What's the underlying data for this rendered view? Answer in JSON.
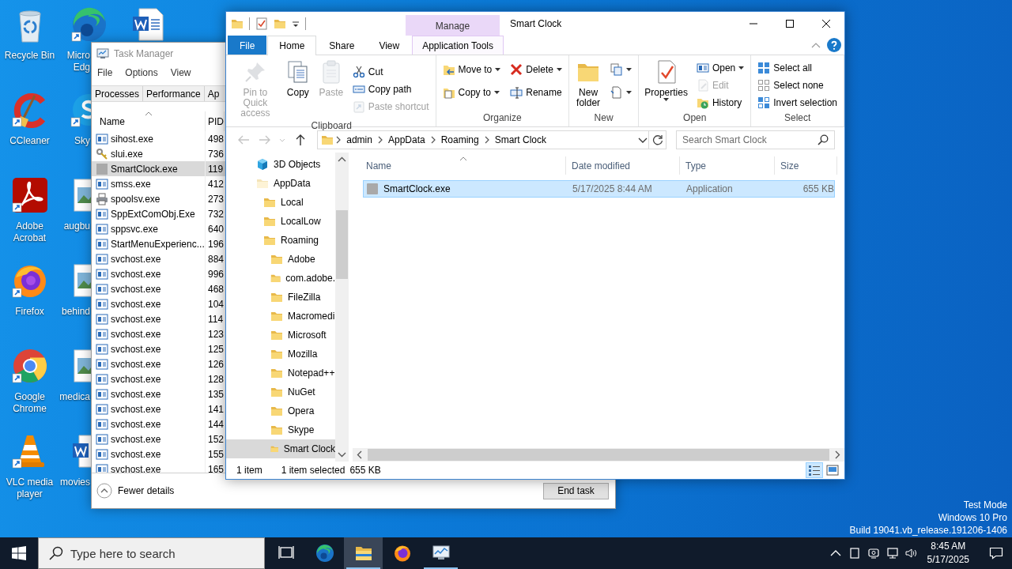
{
  "desktop": {
    "icons": [
      {
        "kind": "recycle",
        "label": "Recycle Bin",
        "shortcut": false
      },
      {
        "kind": "ccleaner",
        "label": "CCleaner",
        "shortcut": true
      },
      {
        "kind": "acrobat",
        "label": "Adobe Acrobat",
        "shortcut": true
      },
      {
        "kind": "firefox",
        "label": "Firefox",
        "shortcut": true
      },
      {
        "kind": "chrome",
        "label": "Google Chrome",
        "shortcut": true
      },
      {
        "kind": "vlc",
        "label": "VLC media player",
        "shortcut": true
      },
      {
        "kind": "edge",
        "label": "Micro Edg",
        "shortcut": true
      },
      {
        "kind": "skype",
        "label": "Sky",
        "shortcut": true
      },
      {
        "kind": "image",
        "label": "augbu",
        "shortcut": false
      },
      {
        "kind": "image",
        "label": "behind",
        "shortcut": false
      },
      {
        "kind": "image",
        "label": "medica",
        "shortcut": false
      },
      {
        "kind": "word",
        "label": "movies",
        "shortcut": false
      },
      {
        "kind": "word",
        "shortcut": false
      }
    ],
    "system_notice": [
      "Test Mode",
      "Windows 10 Pro",
      "Build 19041.vb_release.191206-1406"
    ]
  },
  "task_manager": {
    "title": "Task Manager",
    "menu": [
      "File",
      "Options",
      "View"
    ],
    "tabs": [
      "Processes",
      "Performance",
      "Ap"
    ],
    "columns": [
      {
        "label": "Name",
        "sorted": true
      },
      {
        "label": "PID",
        "sorted": false
      }
    ],
    "processes": [
      {
        "name": "sihost.exe",
        "pid": "498",
        "kind": "app",
        "selected": false
      },
      {
        "name": "slui.exe",
        "pid": "736",
        "kind": "keys",
        "selected": false
      },
      {
        "name": "SmartClock.exe",
        "pid": "119",
        "kind": "blank",
        "selected": true
      },
      {
        "name": "smss.exe",
        "pid": "412",
        "kind": "app",
        "selected": false
      },
      {
        "name": "spoolsv.exe",
        "pid": "273",
        "kind": "printer",
        "selected": false
      },
      {
        "name": "SppExtComObj.Exe",
        "pid": "732",
        "kind": "app",
        "selected": false
      },
      {
        "name": "sppsvc.exe",
        "pid": "640",
        "kind": "app",
        "selected": false
      },
      {
        "name": "StartMenuExperienc...",
        "pid": "196",
        "kind": "app",
        "selected": false
      },
      {
        "name": "svchost.exe",
        "pid": "884",
        "kind": "app",
        "selected": false
      },
      {
        "name": "svchost.exe",
        "pid": "996",
        "kind": "app",
        "selected": false
      },
      {
        "name": "svchost.exe",
        "pid": "468",
        "kind": "app",
        "selected": false
      },
      {
        "name": "svchost.exe",
        "pid": "104",
        "kind": "app",
        "selected": false
      },
      {
        "name": "svchost.exe",
        "pid": "114",
        "kind": "app",
        "selected": false
      },
      {
        "name": "svchost.exe",
        "pid": "123",
        "kind": "app",
        "selected": false
      },
      {
        "name": "svchost.exe",
        "pid": "125",
        "kind": "app",
        "selected": false
      },
      {
        "name": "svchost.exe",
        "pid": "126",
        "kind": "app",
        "selected": false
      },
      {
        "name": "svchost.exe",
        "pid": "128",
        "kind": "app",
        "selected": false
      },
      {
        "name": "svchost.exe",
        "pid": "135",
        "kind": "app",
        "selected": false
      },
      {
        "name": "svchost.exe",
        "pid": "141",
        "kind": "app",
        "selected": false
      },
      {
        "name": "svchost.exe",
        "pid": "144",
        "kind": "app",
        "selected": false
      },
      {
        "name": "svchost.exe",
        "pid": "152",
        "kind": "app",
        "selected": false
      },
      {
        "name": "svchost.exe",
        "pid": "155",
        "kind": "app",
        "selected": false
      },
      {
        "name": "svchost.exe",
        "pid": "165",
        "kind": "app",
        "selected": false
      }
    ],
    "fewer_details": "Fewer details",
    "end_task": "End task"
  },
  "explorer": {
    "title": "Smart Clock",
    "context_group": "Manage",
    "tabs": [
      {
        "label": "File",
        "kind": "file",
        "selected": false
      },
      {
        "label": "Home",
        "kind": "normal",
        "selected": true
      },
      {
        "label": "Share",
        "kind": "normal",
        "selected": false
      },
      {
        "label": "View",
        "kind": "normal",
        "selected": false
      },
      {
        "label": "Application Tools",
        "kind": "context",
        "selected": false
      }
    ],
    "ribbon": [
      {
        "label": "Clipboard",
        "buttons": [
          {
            "kind": "pin",
            "label": "Pin to Quick access",
            "disabled": true,
            "dropdown": false
          },
          {
            "kind": "copy",
            "label": "Copy",
            "disabled": false,
            "dropdown": false
          },
          {
            "kind": "paste",
            "label": "Paste",
            "disabled": true,
            "dropdown": false
          }
        ],
        "stacks": [
          [
            {
              "kind": "cut",
              "label": "Cut",
              "disabled": false,
              "dropdown": false
            },
            {
              "kind": "copypath",
              "label": "Copy path",
              "disabled": false,
              "dropdown": false
            },
            {
              "kind": "pasteshortcut",
              "label": "Paste shortcut",
              "disabled": true,
              "dropdown": false
            }
          ]
        ]
      },
      {
        "label": "Organize",
        "stacks": [
          [
            {
              "kind": "moveto",
              "label": "Move to",
              "disabled": false,
              "dropdown": true
            },
            {
              "kind": "copyto",
              "label": "Copy to",
              "disabled": false,
              "dropdown": true
            }
          ],
          [
            {
              "kind": "delete",
              "label": "Delete",
              "disabled": false,
              "dropdown": true
            },
            {
              "kind": "rename",
              "label": "Rename",
              "disabled": false,
              "dropdown": false
            }
          ]
        ]
      },
      {
        "label": "New",
        "buttons": [
          {
            "kind": "newfolder",
            "label": "New folder",
            "disabled": false,
            "dropdown": false
          }
        ],
        "stacks": [
          [
            {
              "kind": "newitem",
              "disabled": false,
              "dropdown": true
            },
            {
              "kind": "easyaccess",
              "disabled": false,
              "dropdown": true
            }
          ]
        ]
      },
      {
        "label": "Open",
        "buttons": [
          {
            "kind": "properties",
            "label": "Properties",
            "disabled": false,
            "dropdown": true
          }
        ],
        "stacks": [
          [
            {
              "kind": "open",
              "label": "Open",
              "disabled": false,
              "dropdown": true
            },
            {
              "kind": "edit",
              "label": "Edit",
              "disabled": true,
              "dropdown": false
            },
            {
              "kind": "history",
              "label": "History",
              "disabled": false,
              "dropdown": false
            }
          ]
        ]
      },
      {
        "label": "Select",
        "stacks": [
          [
            {
              "kind": "selectall",
              "label": "Select all",
              "disabled": false,
              "dropdown": false
            },
            {
              "kind": "selectnone",
              "label": "Select none",
              "disabled": false,
              "dropdown": false
            },
            {
              "kind": "invert",
              "label": "Invert selection",
              "disabled": false,
              "dropdown": false
            }
          ]
        ]
      }
    ],
    "address": [
      "admin",
      "AppData",
      "Roaming",
      "Smart Clock"
    ],
    "search": {
      "placeholder": "Search Smart Clock"
    },
    "tree": [
      {
        "label": "3D Objects",
        "kind": "cube",
        "selected": false
      },
      {
        "label": "AppData",
        "kind": "folder-faded",
        "selected": false,
        "children": [
          {
            "label": "Local",
            "kind": "folder",
            "selected": false
          },
          {
            "label": "LocalLow",
            "kind": "folder",
            "selected": false
          },
          {
            "label": "Roaming",
            "kind": "folder",
            "selected": false,
            "children": [
              {
                "label": "Adobe",
                "kind": "folder",
                "selected": false
              },
              {
                "label": "com.adobe.",
                "kind": "folder",
                "selected": false
              },
              {
                "label": "FileZilla",
                "kind": "folder",
                "selected": false
              },
              {
                "label": "Macromedi",
                "kind": "folder",
                "selected": false
              },
              {
                "label": "Microsoft",
                "kind": "folder",
                "selected": false
              },
              {
                "label": "Mozilla",
                "kind": "folder",
                "selected": false
              },
              {
                "label": "Notepad++",
                "kind": "folder",
                "selected": false
              },
              {
                "label": "NuGet",
                "kind": "folder",
                "selected": false
              },
              {
                "label": "Opera",
                "kind": "folder",
                "selected": false
              },
              {
                "label": "Skype",
                "kind": "folder",
                "selected": false
              },
              {
                "label": "Smart Clock",
                "kind": "folder",
                "selected": true
              }
            ]
          }
        ]
      }
    ],
    "columns": [
      {
        "label": "Name",
        "sorted": true
      },
      {
        "label": "Date modified",
        "sorted": false
      },
      {
        "label": "Type",
        "sorted": false
      },
      {
        "label": "Size",
        "sorted": false
      }
    ],
    "files": [
      {
        "name": "SmartClock.exe",
        "date_modified": "5/17/2025 8:44 AM",
        "type": "Application",
        "size": "655 KB",
        "selected": true
      }
    ],
    "status": {
      "item_count": "1 item",
      "selection": "1 item selected",
      "selection_size": "655 KB"
    },
    "view_buttons": [
      {
        "kind": "details",
        "selected": true
      },
      {
        "kind": "large-icons",
        "selected": false
      }
    ]
  },
  "taskbar": {
    "search": {
      "placeholder": "Type here to search"
    },
    "apps": [
      {
        "kind": "taskview",
        "active": false,
        "running": false
      },
      {
        "kind": "edge",
        "active": false,
        "running": false
      },
      {
        "kind": "explorer",
        "active": true,
        "running": true
      },
      {
        "kind": "firefox",
        "active": false,
        "running": false
      },
      {
        "kind": "taskmgr",
        "active": false,
        "running": true
      }
    ],
    "time": "8:45 AM",
    "date": "5/17/2025"
  }
}
